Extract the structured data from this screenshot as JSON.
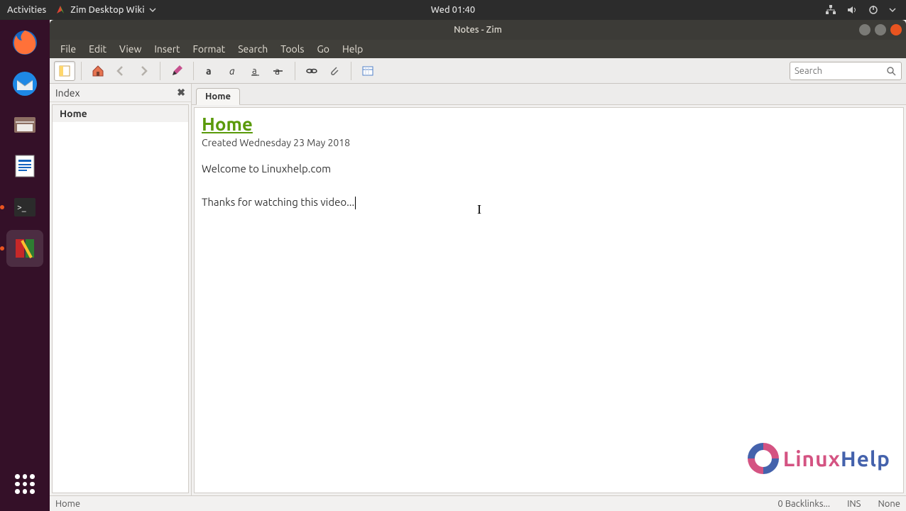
{
  "topbar": {
    "activities": "Activities",
    "appname": "Zim Desktop Wiki",
    "clock": "Wed 01:40"
  },
  "window": {
    "title": "Notes - Zim"
  },
  "menubar": [
    "File",
    "Edit",
    "View",
    "Insert",
    "Format",
    "Search",
    "Tools",
    "Go",
    "Help"
  ],
  "search": {
    "placeholder": "Search"
  },
  "sidebar": {
    "title": "Index",
    "items": [
      "Home"
    ]
  },
  "tabs": [
    "Home"
  ],
  "page": {
    "heading": "Home",
    "created": "Created Wednesday 23 May 2018",
    "body1": "Welcome to Linuxhelp.com",
    "body2": "Thanks for watching this video..."
  },
  "statusbar": {
    "path": "Home",
    "backlinks": "0 Backlinks...",
    "mode": "INS",
    "right": "None"
  },
  "watermark": {
    "a": "Linux",
    "b": "Help"
  }
}
